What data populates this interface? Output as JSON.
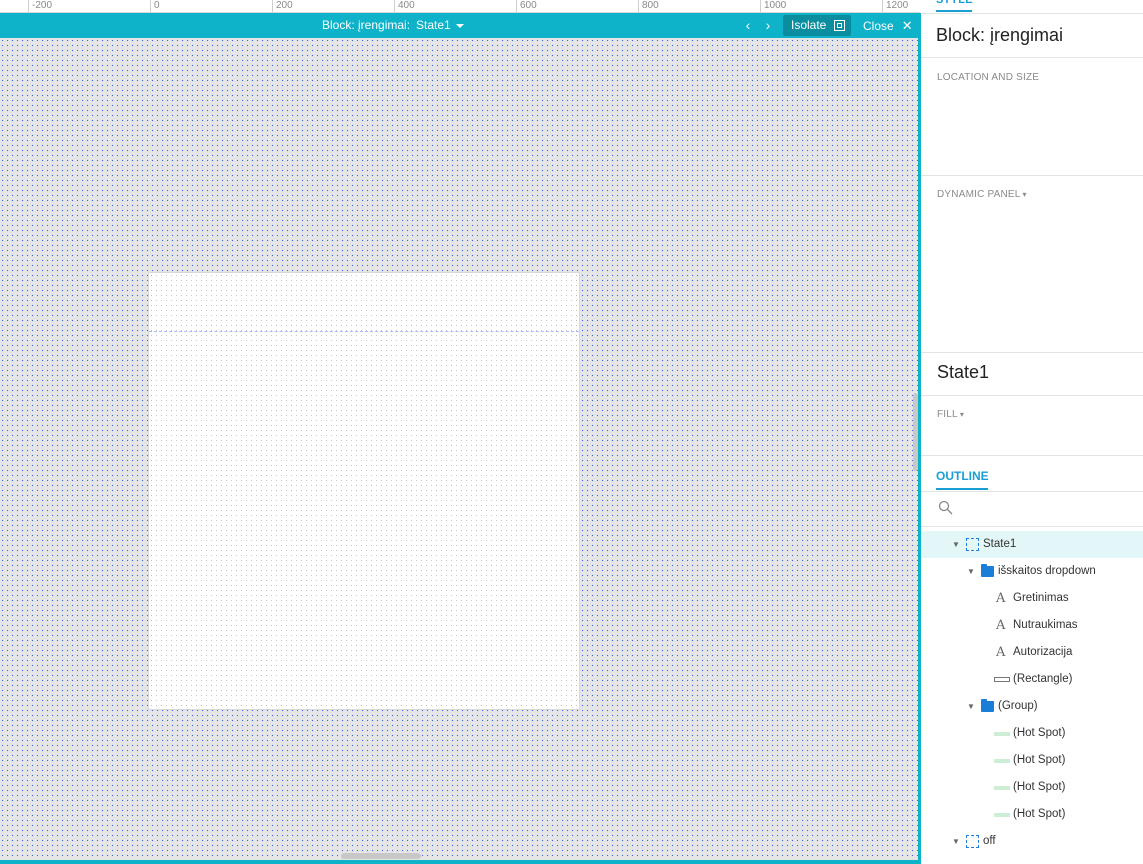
{
  "ruler": {
    "labels": [
      "-200",
      "0",
      "200",
      "400",
      "600",
      "800",
      "1000",
      "1200"
    ]
  },
  "editor_bar": {
    "block_label": "Block: įrengimai:",
    "state_label": "State1",
    "prev_icon": "chevron-left-icon",
    "next_icon": "chevron-right-icon",
    "isolate_label": "Isolate",
    "close_label": "Close"
  },
  "panel": {
    "style_tab": "STYLE",
    "block_title": "Block: įrengimai",
    "location_size_label": "LOCATION AND SIZE",
    "dynamic_panel_label": "DYNAMIC PANEL",
    "state_title": "State1",
    "fill_label": "FILL",
    "outline_tab": "OUTLINE",
    "search_placeholder": ""
  },
  "outline": {
    "items": [
      {
        "label": "State1",
        "type": "state",
        "depth": 0,
        "expanded": true,
        "selected": true
      },
      {
        "label": "išskaitos dropdown",
        "type": "folder",
        "depth": 1,
        "expanded": true
      },
      {
        "label": "Gretinimas",
        "type": "text",
        "depth": 2
      },
      {
        "label": "Nutraukimas",
        "type": "text",
        "depth": 2
      },
      {
        "label": "Autorizacija",
        "type": "text",
        "depth": 2
      },
      {
        "label": "(Rectangle)",
        "type": "rectangle",
        "depth": 2
      },
      {
        "label": "(Group)",
        "type": "folder",
        "depth": 1,
        "expanded": true
      },
      {
        "label": "(Hot Spot)",
        "type": "hotspot",
        "depth": 2
      },
      {
        "label": "(Hot Spot)",
        "type": "hotspot",
        "depth": 2
      },
      {
        "label": "(Hot Spot)",
        "type": "hotspot",
        "depth": 2
      },
      {
        "label": "(Hot Spot)",
        "type": "hotspot",
        "depth": 2
      },
      {
        "label": "off",
        "type": "state",
        "depth": 0,
        "expanded": true
      }
    ]
  },
  "colors": {
    "accent": "#0fb3c9",
    "link_blue": "#1a9fd4",
    "folder_blue": "#1a7ed9",
    "selected_row": "#e3f6f8"
  }
}
